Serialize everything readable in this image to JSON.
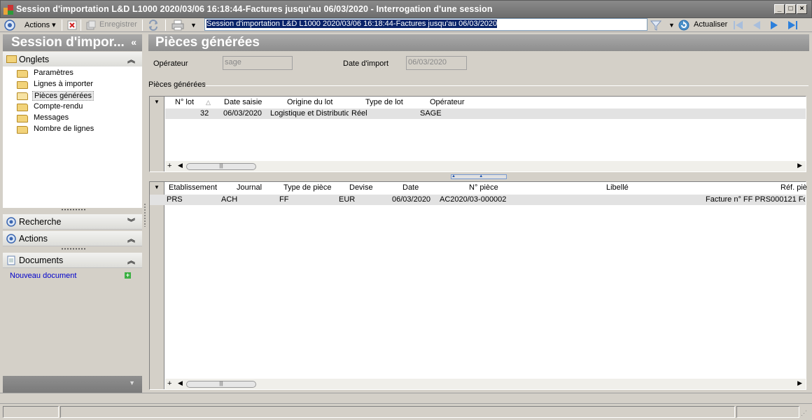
{
  "window": {
    "title": "Session d'importation L&D L1000 2020/03/06 16:18:44-Factures jusqu'au 06/03/2020 -  Interrogation d'une session"
  },
  "toolbar": {
    "actions_label": "Actions",
    "save_label": "Enregistrer",
    "session_value": "Session d'importation L&D L1000 2020/03/06 16:18:44-Factures jusqu'au 06/03/2020",
    "refresh_label": "Actualiser"
  },
  "left": {
    "header": "Session d'impor...",
    "onglets_label": "Onglets",
    "tabs": [
      "Paramètres",
      "Lignes à importer",
      "Pièces générées",
      "Compte-rendu",
      "Messages",
      "Nombre de lignes"
    ],
    "recherche_label": "Recherche",
    "actions_label": "Actions",
    "documents_label": "Documents",
    "new_document_label": "Nouveau document"
  },
  "main": {
    "title": "Pièces générées",
    "operator_label": "Opérateur",
    "operator_value": "sage",
    "import_date_label": "Date d'import",
    "import_date_value": "06/03/2020",
    "group_label": "Pièces générées",
    "lots": {
      "headers": [
        "N° lot",
        "Date saisie",
        "Origine du lot",
        "Type de lot",
        "Opérateur"
      ],
      "rows": [
        [
          "32",
          "06/03/2020",
          "Logistique et Distributic",
          "Réel",
          "SAGE"
        ]
      ]
    },
    "pieces": {
      "headers": [
        "Etablissement",
        "Journal",
        "Type de pièce",
        "Devise",
        "Date",
        "N° pièce",
        "Libellé",
        "Réf. piè"
      ],
      "rows": [
        [
          "PRS",
          "ACH",
          "FF",
          "EUR",
          "06/03/2020",
          "AC2020/03-000002",
          "",
          "Facture n° FF PRS000121 Fo"
        ]
      ]
    }
  },
  "colors": {
    "title_bar": "#7b7b7b",
    "pane_header": "#999999",
    "selection": "#0a246a",
    "link": "#0000cc"
  }
}
